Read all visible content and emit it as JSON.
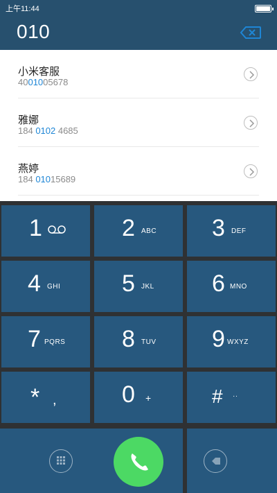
{
  "status_bar": {
    "time": "上午11:44"
  },
  "dialer": {
    "input": "010"
  },
  "results": [
    {
      "name": "小米客服",
      "number_pre": "40",
      "number_hl": "010",
      "number_post": "05678"
    },
    {
      "name": "雅娜",
      "number_pre": "184 ",
      "number_hl": "0102",
      "number_post": " 4685"
    },
    {
      "name": "燕婷",
      "number_pre": "184 ",
      "number_hl": "010",
      "number_post": "15689"
    }
  ],
  "keys": [
    {
      "digit": "1",
      "letters": ""
    },
    {
      "digit": "2",
      "letters": "ABC"
    },
    {
      "digit": "3",
      "letters": "DEF"
    },
    {
      "digit": "4",
      "letters": "GHI"
    },
    {
      "digit": "5",
      "letters": "JKL"
    },
    {
      "digit": "6",
      "letters": "MNO"
    },
    {
      "digit": "7",
      "letters": "PQRS"
    },
    {
      "digit": "8",
      "letters": "TUV"
    },
    {
      "digit": "9",
      "letters": "WXYZ"
    },
    {
      "digit": "*",
      "letters": ","
    },
    {
      "digit": "0",
      "letters": "+"
    },
    {
      "digit": "#",
      "letters": "··"
    }
  ],
  "colors": {
    "header": "#27506e",
    "key": "#27587e",
    "highlight": "#1e86d6",
    "call": "#4cd964",
    "backspace": "#1e86d6"
  },
  "icons": {
    "voicemail": "voicemail-icon",
    "backspace": "backspace-icon",
    "keypad_toggle": "dialpad-icon",
    "call": "phone-icon",
    "more": "more-icon"
  }
}
